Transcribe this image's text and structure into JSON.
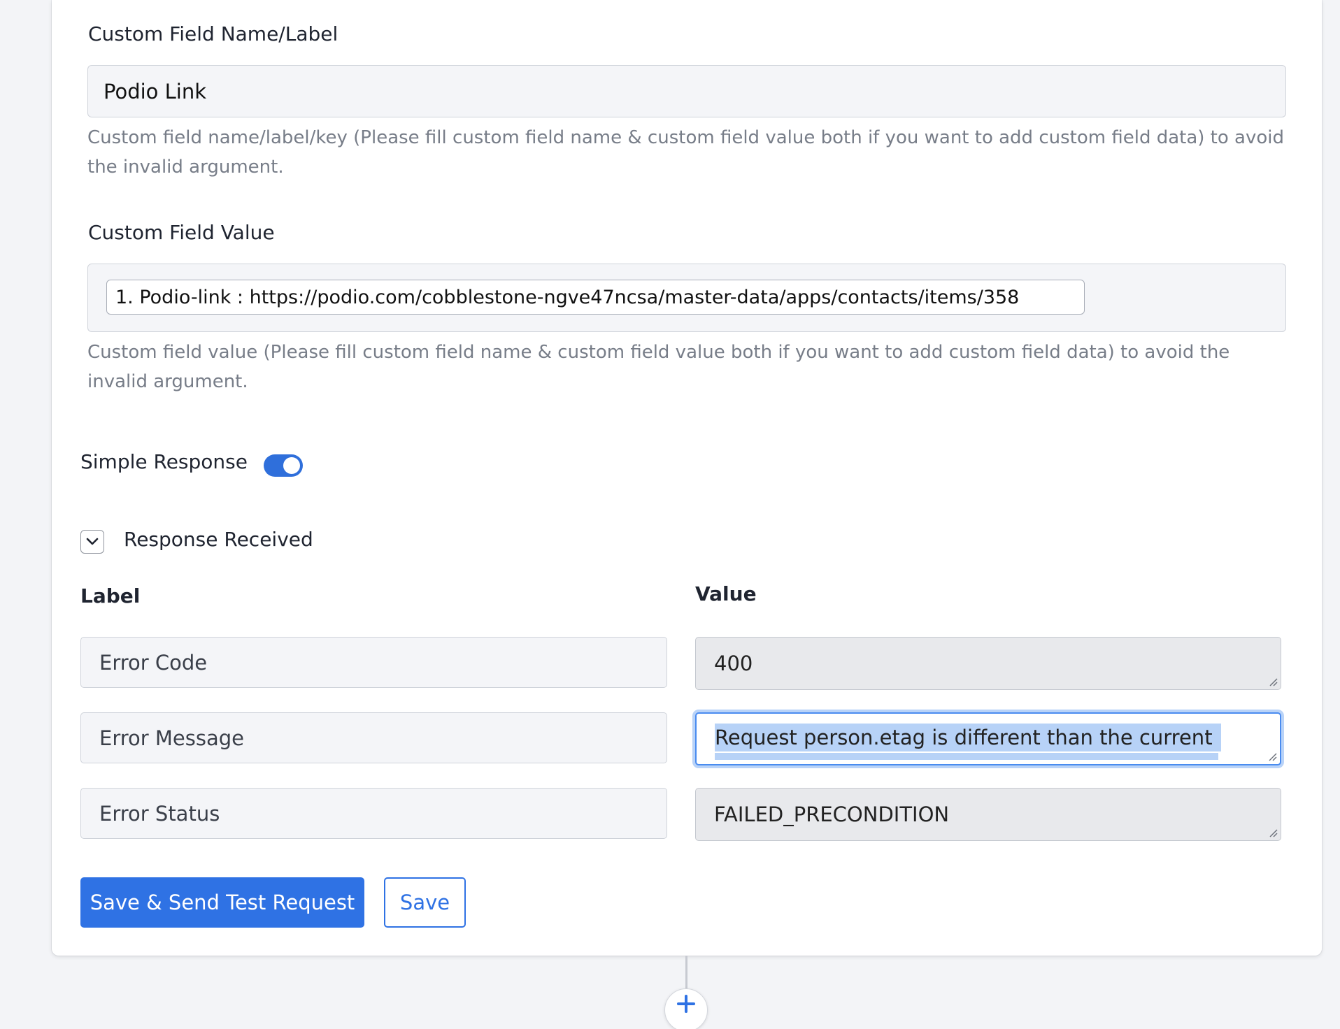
{
  "custom_field_name": {
    "label": "Custom Field Name/Label",
    "value": "Podio Link",
    "help": "Custom field name/label/key (Please fill custom field name & custom field value both if you want to add custom field data) to avoid the invalid argument."
  },
  "custom_field_value": {
    "label": "Custom Field Value",
    "token": "1. Podio-link : https://podio.com/cobblestone-ngve47ncsa/master-data/apps/contacts/items/358",
    "help": "Custom field value (Please fill custom field name & custom field value both if you want to add custom field data) to avoid the invalid argument."
  },
  "simple_response": {
    "label": "Simple Response",
    "enabled": true
  },
  "response_received": {
    "label": "Response Received",
    "expanded": true
  },
  "response_table": {
    "label_header": "Label",
    "value_header": "Value",
    "rows": [
      {
        "label": "Error Code",
        "value": "400"
      },
      {
        "label": "Error Message",
        "value": "Request person.etag is different than the current"
      },
      {
        "label": "Error Status",
        "value": "FAILED_PRECONDITION"
      }
    ]
  },
  "actions": {
    "save_send_label": "Save & Send Test Request",
    "save_label": "Save"
  },
  "add_step": {
    "icon": "plus-icon",
    "symbol": "+"
  },
  "colors": {
    "accent": "#2f72e4",
    "toggle_on": "#2f6fdb",
    "selection": "#b7d2f7"
  }
}
